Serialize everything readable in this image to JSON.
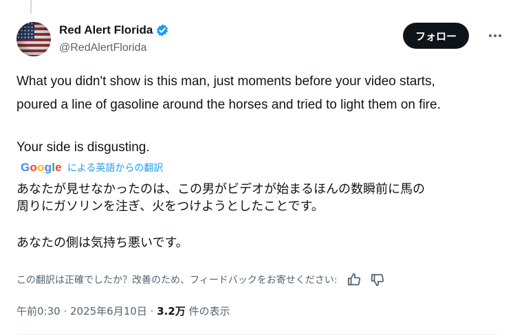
{
  "author": {
    "display_name": "Red Alert Florida",
    "handle": "@RedAlertFlorida",
    "verified": true,
    "avatar": "american-flag"
  },
  "actions": {
    "follow_label": "フォロー",
    "more_icon": "more-horizontal-icon"
  },
  "tweet": {
    "line1": "What you didn't show is this man, just moments before your video starts,",
    "line2": "poured a line of gasoline around the horses and tried to light them on fire.",
    "line3": "Your side is disgusting."
  },
  "translation": {
    "provider": "Google",
    "label": "による英語からの翻訳",
    "ja_line1": "あなたが見せなかったのは、この男がビデオが始まるほんの数瞬前に馬の",
    "ja_line2": "周りにガソリンを注ぎ、火をつけようとしたことです。",
    "ja_line3": "あなたの側は気持ち悪いです。",
    "feedback_prompt": "この翻訳は正確でしたか？改善のため、フィードバックをお寄せください:"
  },
  "meta": {
    "time": "午前0:30",
    "sep1": " · ",
    "date": "2025年6月10日",
    "sep2": " · ",
    "views_count": "3.2万",
    "views_label": " 件の表示"
  },
  "colors": {
    "text": "#0f1419",
    "secondary": "#536471",
    "link": "#1d9bf0",
    "verified": "#1d9bf0",
    "follow_bg": "#0f1419"
  }
}
